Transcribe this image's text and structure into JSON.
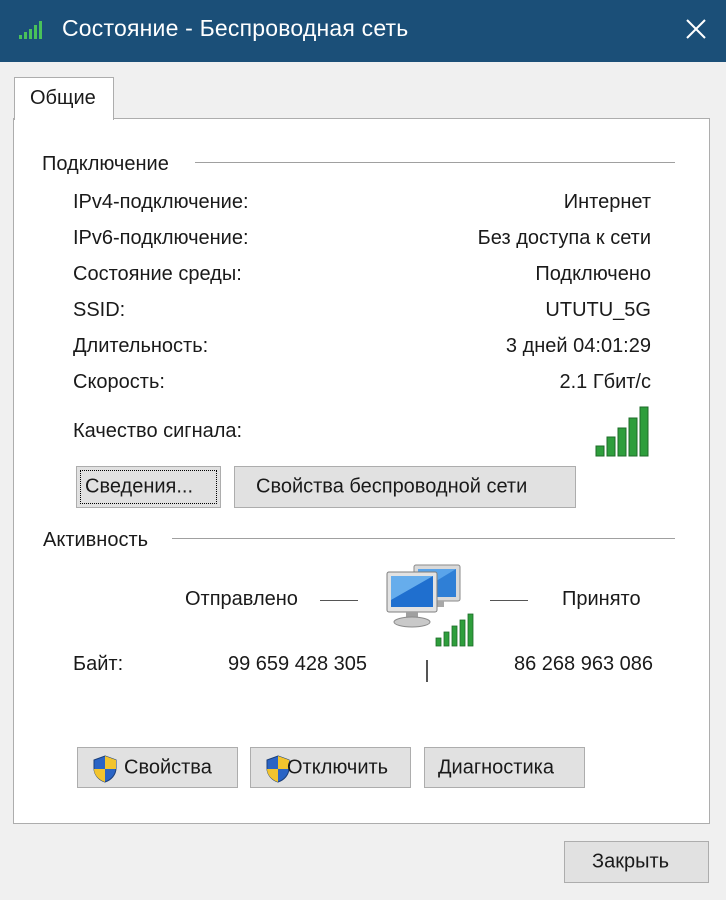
{
  "window": {
    "title": "Состояние - Беспроводная сеть",
    "close_glyph": "✕"
  },
  "tabs": [
    {
      "label": "Общие"
    }
  ],
  "connection": {
    "section_title": "Подключение",
    "rows": [
      {
        "label": "IPv4-подключение:",
        "value": "Интернет"
      },
      {
        "label": "IPv6-подключение:",
        "value": "Без доступа к сети"
      },
      {
        "label": "Состояние среды:",
        "value": "Подключено"
      },
      {
        "label": "SSID:",
        "value": "UTUTU_5G"
      },
      {
        "label": "Длительность:",
        "value": "3 дней 04:01:29"
      },
      {
        "label": "Скорость:",
        "value": "2.1 Гбит/с"
      }
    ],
    "signal_label": "Качество сигнала:",
    "signal_bars": 5,
    "details_button": "Сведения...",
    "wireless_props_button": "Свойства беспроводной сети"
  },
  "activity": {
    "section_title": "Активность",
    "sent_label": "Отправлено",
    "received_label": "Принято",
    "bytes_label": "Байт:",
    "sent_bytes": "99 659 428 305",
    "received_bytes": "86 268 963 086"
  },
  "actions": {
    "properties": "Свойства",
    "disconnect": "Отключить",
    "diagnostics": "Диагностика"
  },
  "footer": {
    "close_button": "Закрыть"
  },
  "colors": {
    "titlebar": "#1b4f78",
    "signal_green": "#2e9e3c",
    "panel": "#ffffff",
    "window": "#f0f0f0"
  },
  "icons": [
    "signal-bars-icon",
    "close-icon",
    "uac-shield-icon",
    "network-computers-icon"
  ]
}
